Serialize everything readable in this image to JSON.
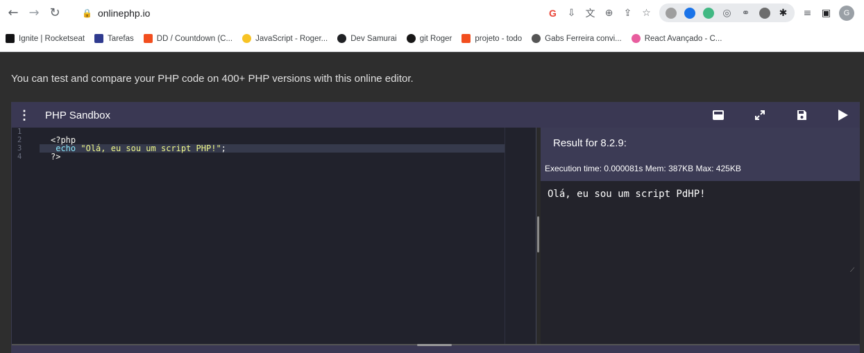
{
  "browser": {
    "url": "onlinephp.io",
    "bookmarks": [
      {
        "label": "Ignite | Rocketseat",
        "color": "#121214"
      },
      {
        "label": "Tarefas",
        "color": "#2f3a8f"
      },
      {
        "label": "DD / Countdown (C...",
        "color": "#f24e1e"
      },
      {
        "label": "JavaScript - Roger...",
        "color": "#f7c325"
      },
      {
        "label": "Dev Samurai",
        "color": "#202124"
      },
      {
        "label": "git Roger",
        "color": "#181717"
      },
      {
        "label": "projeto - todo",
        "color": "#f24e1e"
      },
      {
        "label": "Gabs Ferreira convi...",
        "color": "#555555"
      },
      {
        "label": "React Avançado - C...",
        "color": "#e85d9e"
      }
    ],
    "avatar_initial": "G"
  },
  "page": {
    "intro": "You can test and compare your PHP code on 400+ PHP versions with this online editor."
  },
  "sandbox": {
    "title": "PHP Sandbox",
    "line_numbers": [
      "1",
      "2",
      "3",
      "4"
    ],
    "code": {
      "line2": "<?php",
      "line3_kw": "echo",
      "line3_str": "\"Olá, eu sou um script PHP!\"",
      "line3_end": ";",
      "line4": "?>"
    },
    "result_title": "Result for 8.2.9:",
    "exec_info": "Execution time: 0.000081s Mem: 387KB Max: 425KB",
    "output": "Olá, eu sou um script PdHP!"
  }
}
